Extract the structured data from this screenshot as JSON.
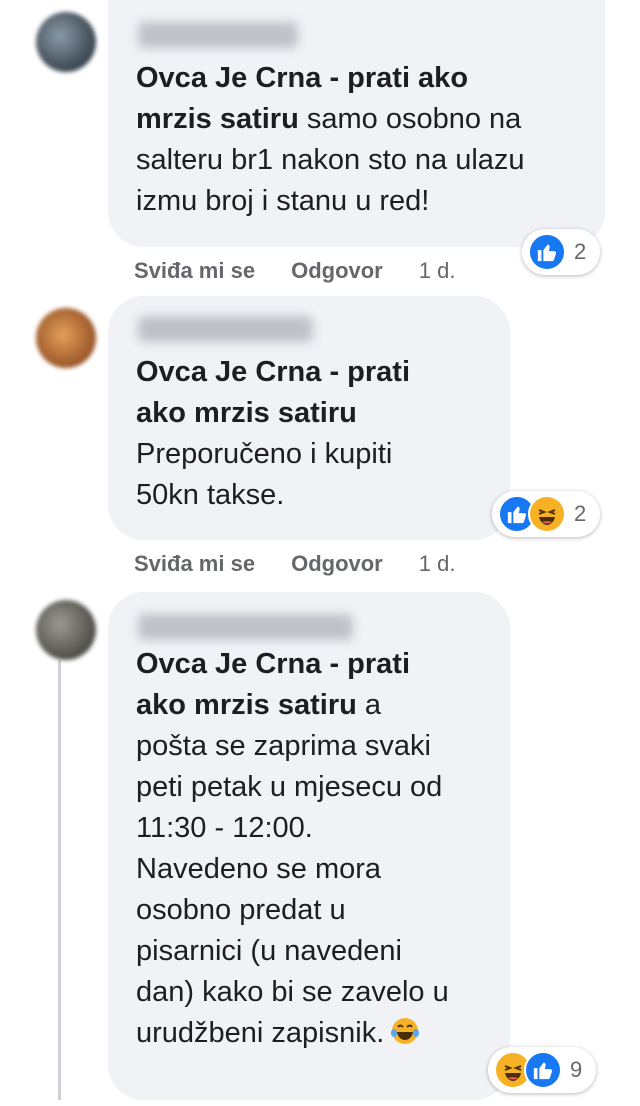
{
  "comments": [
    {
      "tag": "Ovca Je Crna - prati ako mrzis satiru",
      "tag_line1": "Ovca Je Crna - prati ako",
      "tag_line2": "mrzis satiru",
      "body": "samo osobno na salteru br1 nakon sto na ulazu izmu broj i stanu u red!",
      "body_line1": " samo osobno na",
      "body_line2": "salteru br1 nakon sto na ulazu",
      "body_line3": "izmu broj i stanu u red!",
      "like_label": "Sviđa mi se",
      "reply_label": "Odgovor",
      "time": "1 d.",
      "reactions": [
        "like-icon"
      ],
      "reaction_count": "2"
    },
    {
      "tag": "Ovca Je Crna - prati ako mrzis satiru",
      "tag_line1": "Ovca Je Crna - prati",
      "tag_line2": "ako mrzis satiru",
      "body": "Preporučeno i kupiti 50kn takse.",
      "body_line1": "Preporučeno i kupiti",
      "body_line2": "50kn takse.",
      "like_label": "Sviđa mi se",
      "reply_label": "Odgovor",
      "time": "1 d.",
      "reactions": [
        "like-icon",
        "haha-icon"
      ],
      "reaction_count": "2"
    },
    {
      "tag": "Ovca Je Crna - prati ako mrzis satiru",
      "tag_line1": "Ovca Je Crna - prati",
      "tag_line2": "ako mrzis satiru",
      "body": "a pošta se zaprima svaki peti petak u mjesecu od 11:30 - 12:00. Navedeno se mora osobno predat u pisarnici (u navedeni dan) kako bi se zavelo u urudžbeni zapisnik.",
      "body_line1": " a",
      "body_line2": "pošta se zaprima svaki",
      "body_line3": "peti petak u mjesecu od",
      "body_line4": "11:30 - 12:00.",
      "body_line5": "Navedeno se mora",
      "body_line6": "osobno predat u",
      "body_line7": "pisarnici (u navedeni",
      "body_line8": "dan) kako bi se zavelo u",
      "body_line9": "urudžbeni zapisnik.",
      "inline_emoji": "tears-of-joy-emoji",
      "reactions": [
        "haha-icon",
        "like-icon"
      ],
      "reaction_count": "9"
    }
  ],
  "colors": {
    "bubble": "#f0f2f5",
    "like": "#1877f2",
    "haha": "#f7b125",
    "meta": "#65676b"
  }
}
